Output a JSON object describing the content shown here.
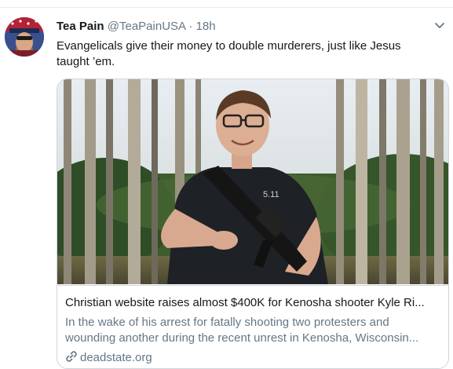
{
  "tweet": {
    "display_name": "Tea Pain",
    "handle": "@TeaPainUSA",
    "separator": "·",
    "time": "18h",
    "text_line1": "Evangelicals give their money to double murderers, just like Jesus",
    "text_line2": "taught ’em."
  },
  "card": {
    "title": "Christian website raises almost $400K for Kenosha shooter Kyle Ri...",
    "desc_line1": "In the wake of his arrest for fatally shooting two protesters and",
    "desc_line2": "wounding another during the recent unrest in Kenosha, Wisconsin...",
    "domain": "deadstate.org",
    "shirt_text": "5.11"
  },
  "icons": {
    "avatar": "avatar-image",
    "more": "chevron-down-icon",
    "link": "link-icon"
  },
  "colors": {
    "primary_text": "#14171a",
    "secondary_text": "#657786",
    "border": "#ccd6dd"
  }
}
